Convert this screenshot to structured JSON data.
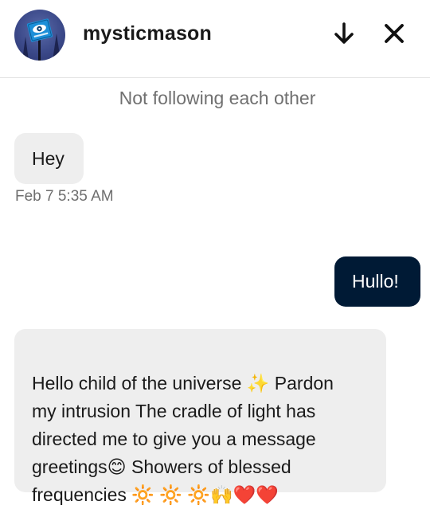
{
  "conversation": {
    "username": "mysticmason",
    "avatar_icon": "caution-eye-sign-icon",
    "status": "Not following each other",
    "header_actions": {
      "minimize_icon": "arrow-down-icon",
      "close_icon": "close-icon"
    }
  },
  "messages": [
    {
      "direction": "incoming",
      "text": "Hey",
      "timestamp": "Feb 7 5:35 AM"
    },
    {
      "direction": "outgoing",
      "text": "Hullo!"
    },
    {
      "direction": "incoming",
      "text": "Hello child of the universe ✨ Pardon\nmy intrusion The cradle of light has\ndirected me to give you a message\ngreetings😊 Showers of blessed\nfrequencies 🔆 🔆 🔆🙌❤️❤️"
    }
  ],
  "colors": {
    "incoming_bubble": "#eeeeee",
    "outgoing_bubble": "#001a35",
    "status_text": "#707070",
    "divider": "#e3e3e3"
  }
}
